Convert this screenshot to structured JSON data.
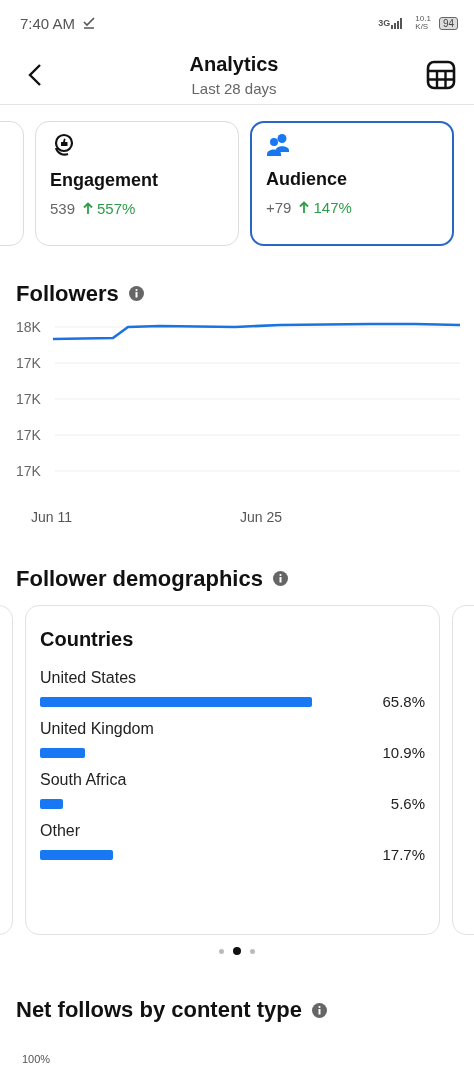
{
  "status_bar": {
    "time": "7:40 AM",
    "network": "3G",
    "speed": "10.1",
    "speed_unit": "K/S",
    "battery": "94"
  },
  "header": {
    "title": "Analytics",
    "subtitle": "Last 28 days"
  },
  "metric_cards": [
    {
      "kind": "partial",
      "selected": false
    },
    {
      "kind": "engagement",
      "title": "Engagement",
      "value": "539",
      "change": "557%",
      "selected": false
    },
    {
      "kind": "audience",
      "title": "Audience",
      "value": "+79",
      "change": "147%",
      "selected": true
    }
  ],
  "followers": {
    "title": "Followers",
    "y_labels": [
      "18K",
      "17K",
      "17K",
      "17K",
      "17K"
    ],
    "x_labels": [
      "Jun 11",
      "Jun 25"
    ]
  },
  "demographics": {
    "title": "Follower demographics",
    "card": {
      "title": "Countries",
      "rows": [
        {
          "label": "United States",
          "value": "65.8%"
        },
        {
          "label": "United Kingdom",
          "value": "10.9%"
        },
        {
          "label": "South Africa",
          "value": "5.6%"
        },
        {
          "label": "Other",
          "value": "17.7%"
        }
      ]
    },
    "pages": [
      {
        "selected": false
      },
      {
        "selected": true
      },
      {
        "selected": false
      }
    ]
  },
  "net_follows": {
    "title": "Net follows by content type",
    "y_label": "100%"
  }
}
